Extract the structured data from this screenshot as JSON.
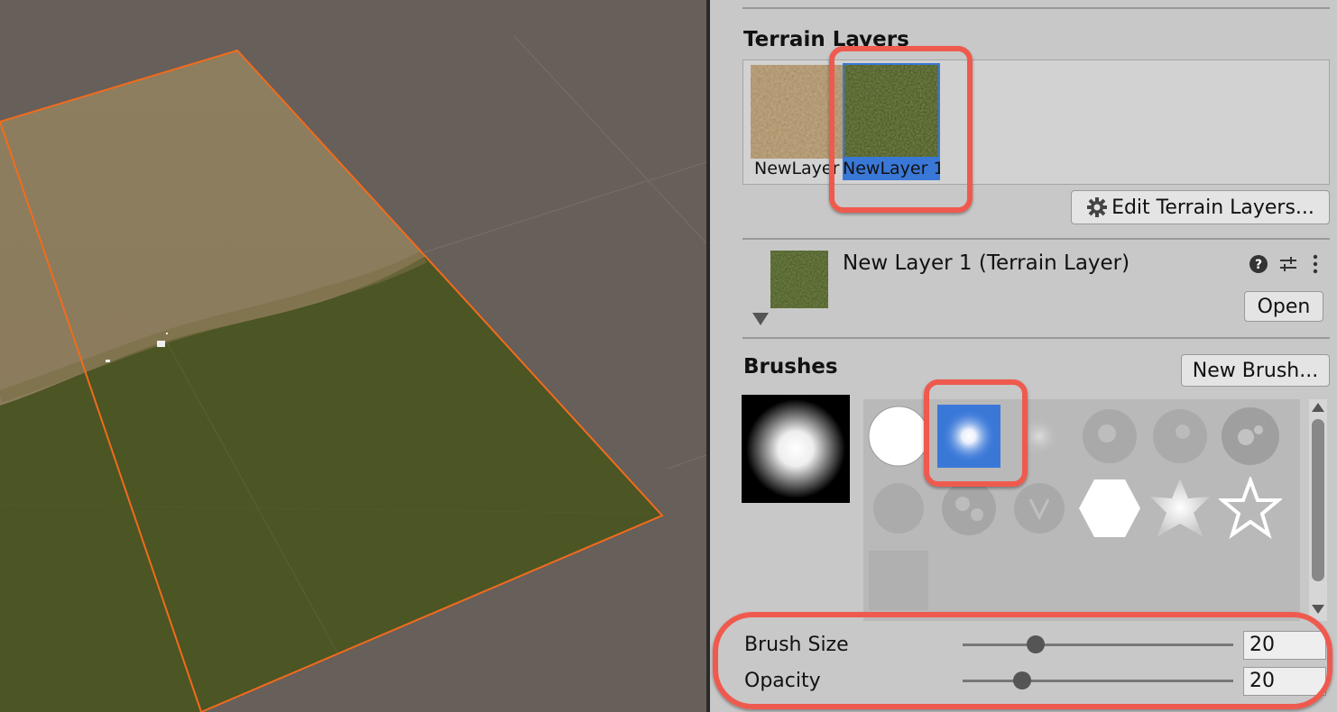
{
  "terrain_layers": {
    "title": "Terrain Layers",
    "layers": [
      {
        "label": "NewLayer",
        "selected": false
      },
      {
        "label": "NewLayer 1",
        "selected": true
      }
    ],
    "edit_button": "Edit Terrain Layers..."
  },
  "layer_detail": {
    "title": "New Layer 1 (Terrain Layer)",
    "open_button": "Open"
  },
  "brushes": {
    "title": "Brushes",
    "new_brush_button": "New Brush...",
    "selected_index": 1
  },
  "brush_size": {
    "label": "Brush Size",
    "value": "20",
    "fraction": 0.27
  },
  "opacity": {
    "label": "Opacity",
    "value": "20",
    "fraction": 0.22
  },
  "colors": {
    "selection": "#3a78d8",
    "callout": "#ef5a4e",
    "terrain_outline": "#f26b1d",
    "sand": "#8c7c5c",
    "grass": "#4c5524"
  }
}
